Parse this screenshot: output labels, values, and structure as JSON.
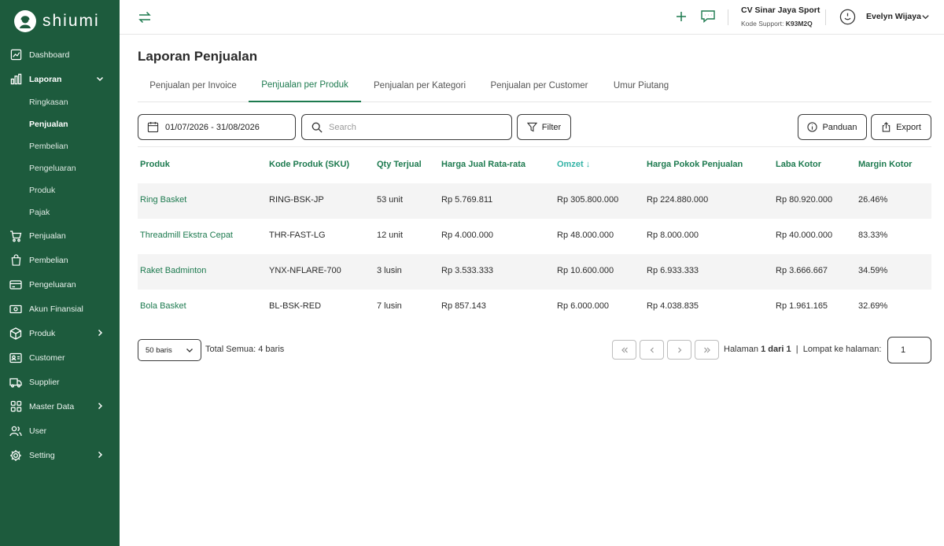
{
  "app": {
    "name": "shiumi"
  },
  "sidebar": {
    "items": [
      {
        "label": "Dashboard"
      },
      {
        "label": "Laporan",
        "sub": [
          "Ringkasan",
          "Penjualan",
          "Pembelian",
          "Pengeluaran",
          "Produk",
          "Pajak"
        ]
      },
      {
        "label": "Penjualan"
      },
      {
        "label": "Pembelian"
      },
      {
        "label": "Pengeluaran"
      },
      {
        "label": "Akun Finansial"
      },
      {
        "label": "Produk"
      },
      {
        "label": "Customer"
      },
      {
        "label": "Supplier"
      },
      {
        "label": "Master Data"
      },
      {
        "label": "User"
      },
      {
        "label": "Setting"
      }
    ]
  },
  "header": {
    "company_name": "CV Sinar Jaya Sport",
    "support_label": "Kode Support:",
    "support_code": "K93M2Q",
    "user_name": "Evelyn Wijaya"
  },
  "main": {
    "title": "Laporan Penjualan",
    "tabs": [
      {
        "label": "Penjualan per Invoice"
      },
      {
        "label": "Penjualan per Produk"
      },
      {
        "label": "Penjualan per Kategori"
      },
      {
        "label": "Penjualan per Customer"
      },
      {
        "label": "Umur Piutang"
      }
    ],
    "date_range": "01/07/2026 - 31/08/2026",
    "search_placeholder": "Search",
    "filter_label": "Filter",
    "guide_label": "Panduan",
    "export_label": "Export"
  },
  "table": {
    "headers": [
      "Produk",
      "Kode Produk (SKU)",
      "Qty Terjual",
      "Harga Jual Rata-rata",
      "Omzet",
      "Harga Pokok Penjualan",
      "Laba Kotor",
      "Margin Kotor"
    ],
    "sort_indicator": "↓",
    "rows": [
      [
        "Ring Basket",
        "RING-BSK-JP",
        "53 unit",
        "Rp 5.769.811",
        "Rp 305.800.000",
        "Rp 224.880.000",
        "Rp 80.920.000",
        "26.46%"
      ],
      [
        "Threadmill Ekstra Cepat",
        "THR-FAST-LG",
        "12 unit",
        "Rp 4.000.000",
        "Rp 48.000.000",
        "Rp 8.000.000",
        "Rp 40.000.000",
        "83.33%"
      ],
      [
        "Raket Badminton",
        "YNX-NFLARE-700",
        "3 lusin",
        "Rp 3.533.333",
        "Rp 10.600.000",
        "Rp 6.933.333",
        "Rp 3.666.667",
        "34.59%"
      ],
      [
        "Bola Basket",
        "BL-BSK-RED",
        "7 lusin",
        "Rp 857.143",
        "Rp 6.000.000",
        "Rp 4.038.835",
        "Rp 1.961.165",
        "32.69%"
      ]
    ]
  },
  "pagination": {
    "rows_per_page": "50 baris",
    "total": "Total Semua: 4 baris",
    "page_prefix": "Halaman",
    "page_current": "1 dari 1",
    "jump_label": "Lompat ke halaman:",
    "jump_value": "1"
  },
  "colors": {
    "sidebar": "#1d5b3d",
    "accent": "#1d7a4f",
    "sorted": "#33b3a6"
  }
}
